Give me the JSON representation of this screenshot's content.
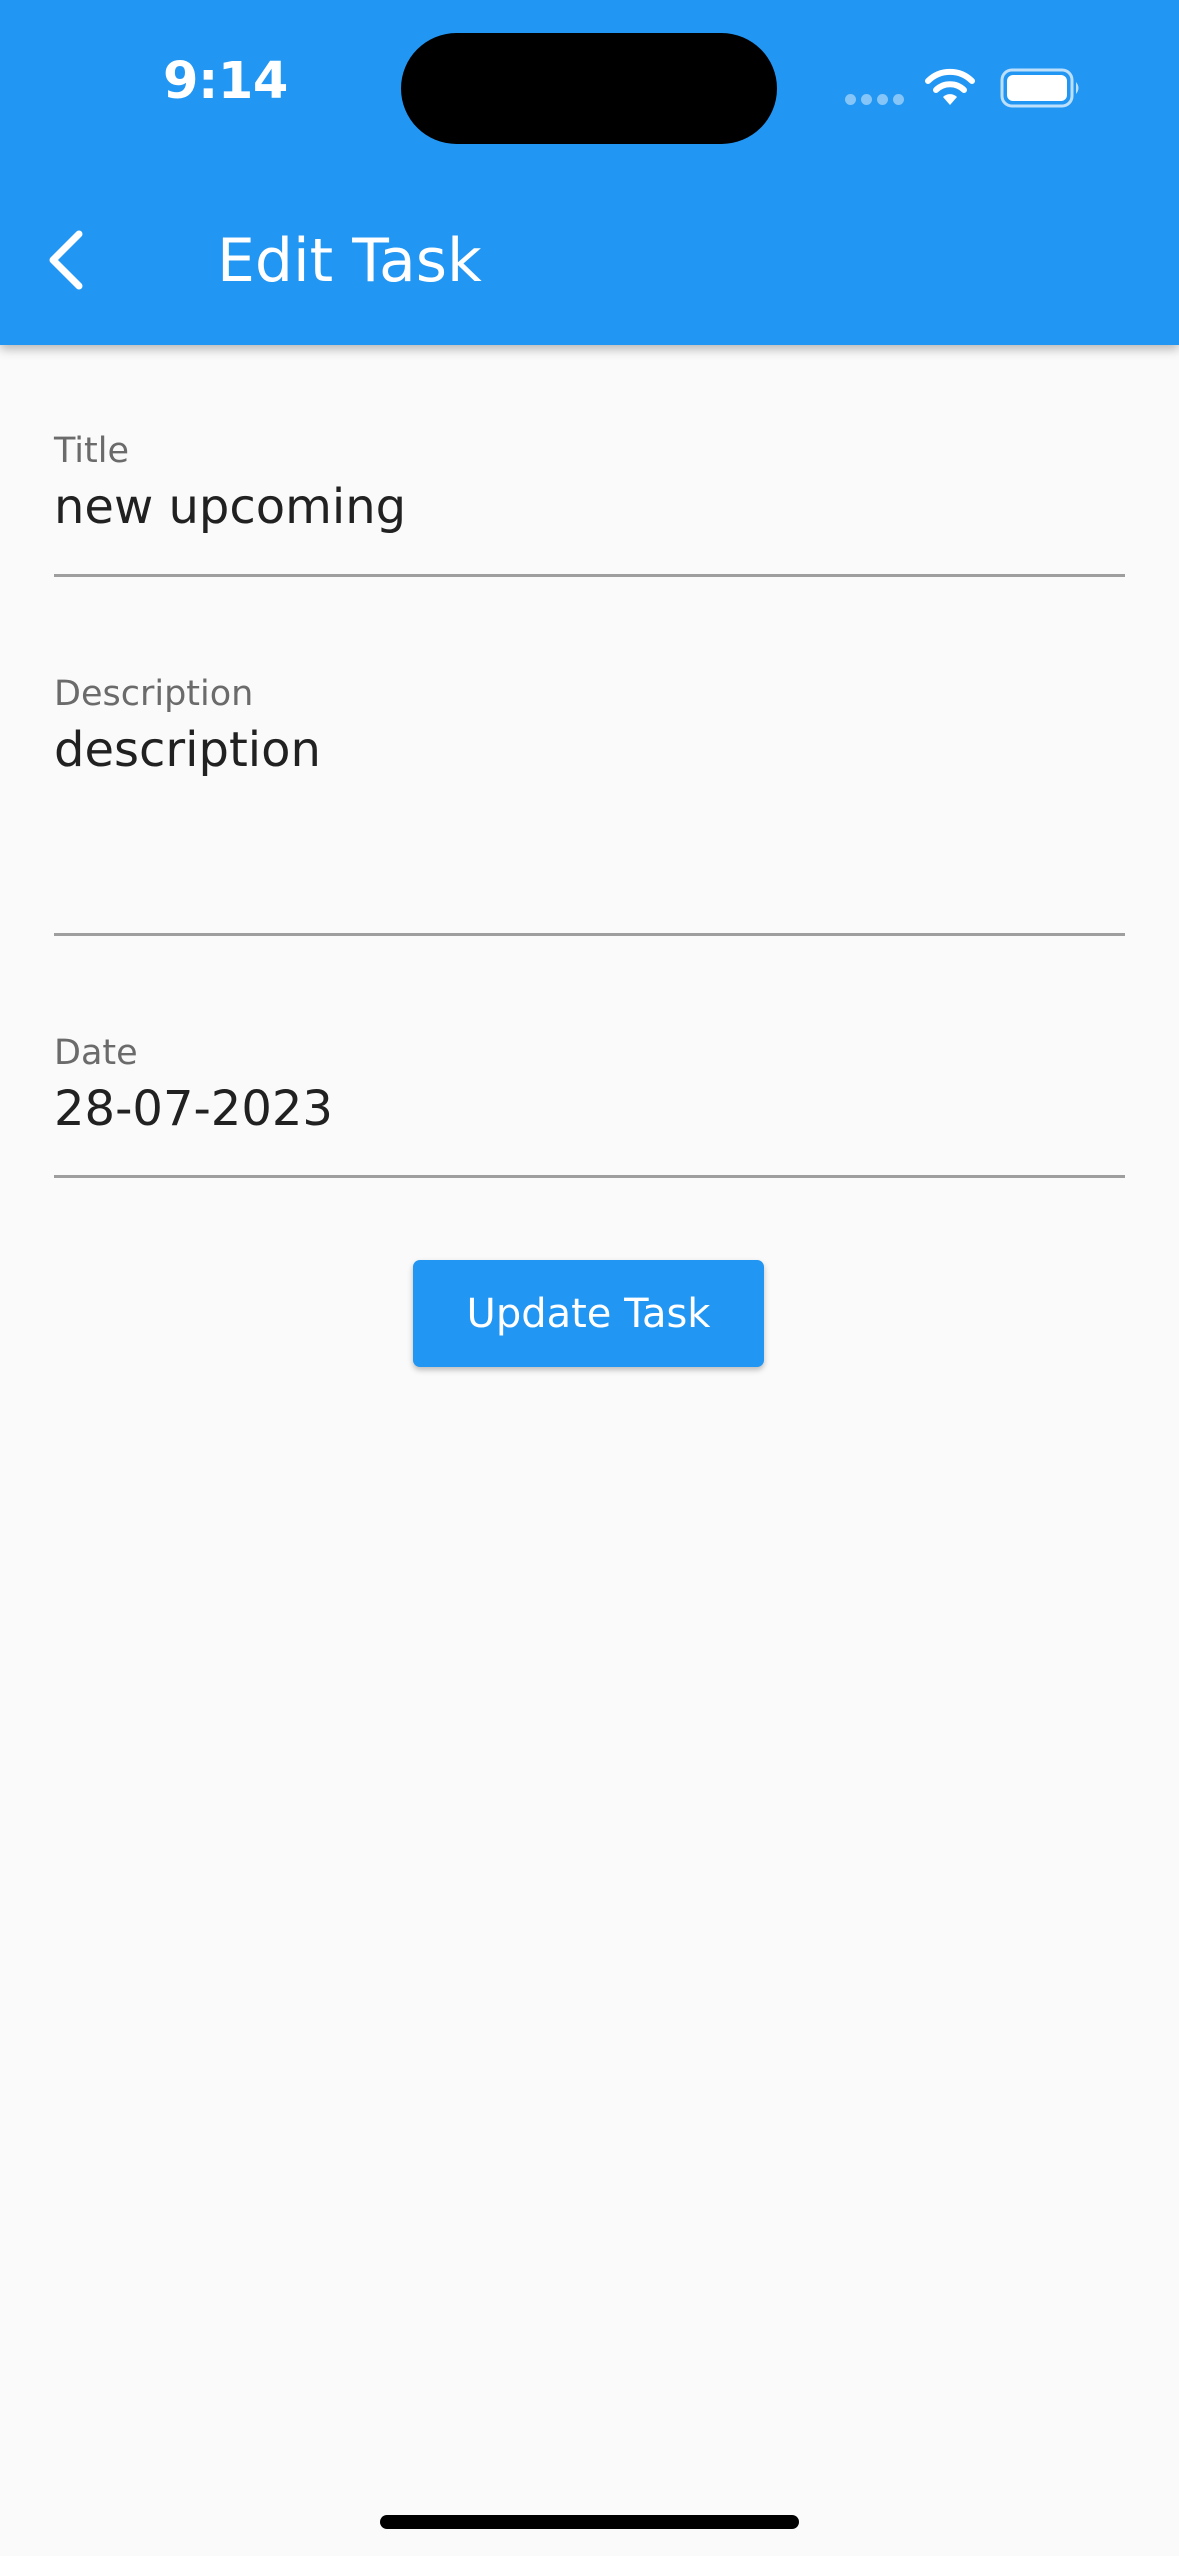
{
  "status_bar": {
    "time": "9:14",
    "icons": [
      "signal-icon",
      "wifi-icon",
      "battery-icon"
    ]
  },
  "app_bar": {
    "title": "Edit Task",
    "back_icon": "chevron-left-icon",
    "color": "#2196f3"
  },
  "form": {
    "title": {
      "label": "Title",
      "value": "new upcoming"
    },
    "description": {
      "label": "Description",
      "value": "description"
    },
    "date": {
      "label": "Date",
      "value": "28-07-2023"
    }
  },
  "actions": {
    "update_label": "Update Task"
  }
}
